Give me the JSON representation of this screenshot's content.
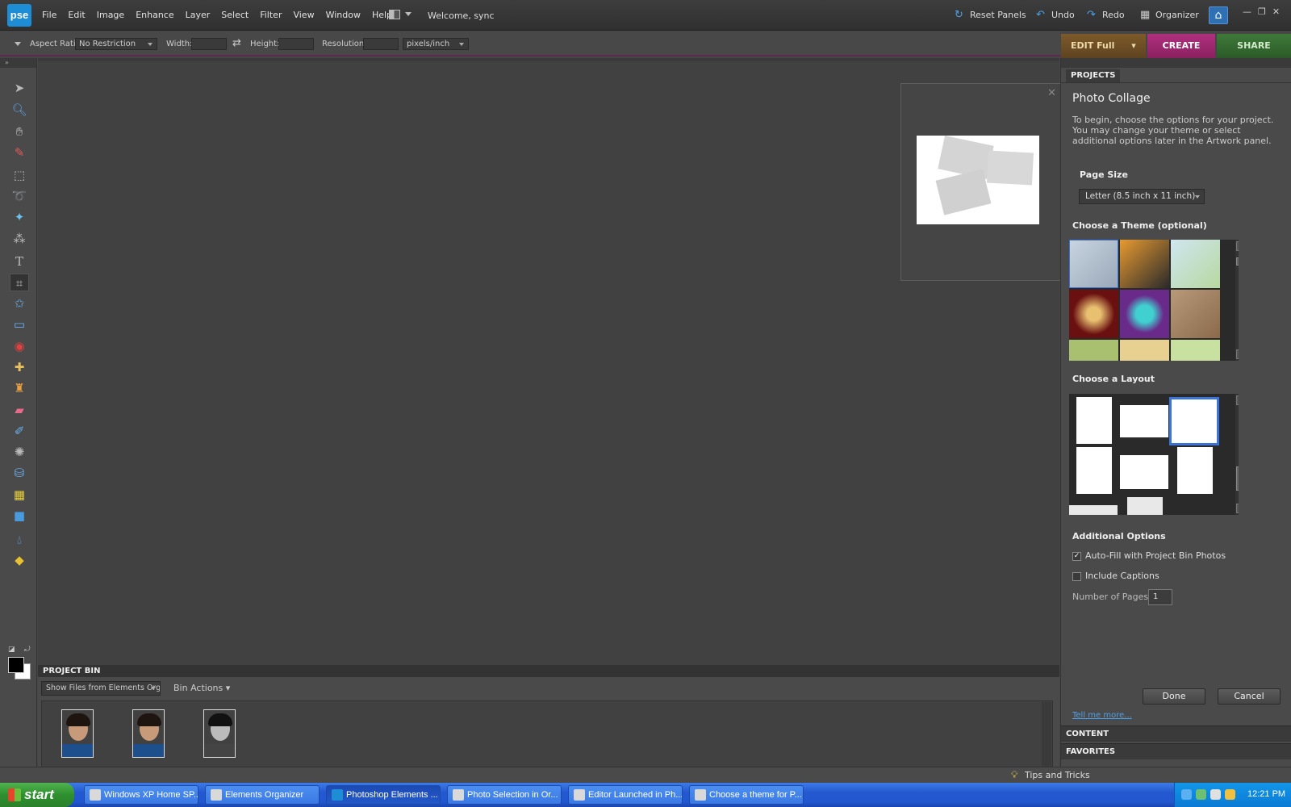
{
  "app": {
    "logo": "pse",
    "welcome": "Welcome, sync"
  },
  "menu": [
    "File",
    "Edit",
    "Image",
    "Enhance",
    "Layer",
    "Select",
    "Filter",
    "View",
    "Window",
    "Help"
  ],
  "top_right": {
    "reset_panels": "Reset Panels",
    "undo": "Undo",
    "redo": "Redo",
    "organizer": "Organizer"
  },
  "modes": {
    "edit": "EDIT Full",
    "create": "CREATE",
    "share": "SHARE"
  },
  "options_bar": {
    "aspect_ratio_label": "Aspect Ratio:",
    "aspect_ratio_value": "No Restriction",
    "width_label": "Width:",
    "height_label": "Height:",
    "resolution_label": "Resolution:",
    "resolution_unit": "pixels/inch"
  },
  "project_bin": {
    "title": "PROJECT BIN",
    "show_files": "Show Files from Elements Orga",
    "bin_actions": "Bin Actions"
  },
  "projects_panel": {
    "tab": "PROJECTS",
    "title": "Photo Collage",
    "description": "To begin, choose the options for your project. You may change your theme or select additional options later in the Artwork panel.",
    "page_size_label": "Page Size",
    "page_size_value": "Letter (8.5 inch x 11 inch)",
    "theme_label": "Choose a Theme (optional)",
    "layout_label": "Choose a Layout",
    "additional_options_label": "Additional Options",
    "autofill_label": "Auto-Fill with Project Bin Photos",
    "autofill_checked": true,
    "include_captions_label": "Include Captions",
    "include_captions_checked": false,
    "num_pages_label": "Number of Pages",
    "num_pages_value": "1",
    "done_label": "Done",
    "cancel_label": "Cancel",
    "tell_me_more": "Tell me more...",
    "content_section": "CONTENT",
    "favorites_section": "FAVORITES"
  },
  "status": {
    "tips": "Tips and Tricks"
  },
  "taskbar": {
    "start": "start",
    "tasks": [
      "Windows XP Home SP...",
      "Elements Organizer",
      "Photoshop Elements ...",
      "Photo Selection in Or...",
      "Editor Launched in Ph...",
      "Choose a theme for P..."
    ],
    "active_task_index": 2,
    "clock": "12:21 PM"
  },
  "colors": {
    "accent_create": "#b0307f",
    "accent_share": "#3f7a3a",
    "accent_edit": "#7d5a2a",
    "link": "#4ea0e8",
    "selection": "#3a74d8"
  }
}
